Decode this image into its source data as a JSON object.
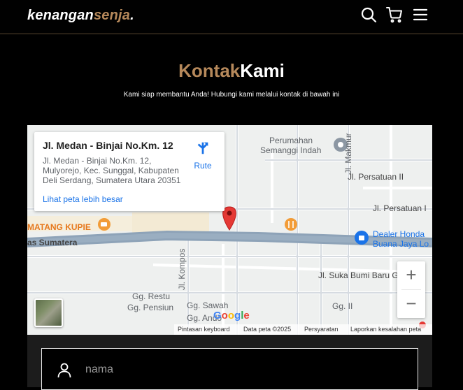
{
  "navbar": {
    "logo_part1": "kenangan",
    "logo_part2": "senja",
    "logo_part3": ".",
    "icons": [
      "search-icon",
      "cart-icon",
      "menu-icon"
    ]
  },
  "contact": {
    "title_part1": "Kontak",
    "title_part2": "Kami",
    "subtitle": "Kami siap membantu Anda! Hubungi kami melalui kontak di bawah ini"
  },
  "map": {
    "place_title": "Jl. Medan - Binjai No.Km. 12",
    "place_address": "Jl. Medan - Binjai No.Km. 12, Mulyorejo, Kec. Sunggal, Kabupaten Deli Serdang, Sumatera Utara 20351",
    "route_label": "Rute",
    "larger_map_link": "Lihat peta lebih besar",
    "labels": {
      "perumahan": "Perumahan",
      "semanggi": "Semanggi Indah",
      "makmur": "Jl. Makmur",
      "persatuan2": "Jl. Persatuan II",
      "persatuan1": "Jl. Persatuan I",
      "matang": "MATANG KUPIE",
      "sumatera": "as Sumatera",
      "dealer1": "Dealer Honda",
      "dealer2": "Buana Jaya Lo",
      "kompos": "Jl. Kompos",
      "sukabumi": "Jl. Suka Bumi Baru G",
      "restu": "Gg. Restu",
      "pensiun": "Gg. Pensiun",
      "sawah": "Gg. Sawah",
      "ando": "Gg. Ando",
      "gg2": "Gg. II"
    },
    "google_text": "Google",
    "footer_keyboard": "Pintasan keyboard",
    "footer_data": "Data peta ©2025",
    "footer_terms": "Persyaratan",
    "footer_report": "Laporkan kesalahan peta",
    "zoom_in": "+",
    "zoom_out": "−"
  },
  "form": {
    "name_placeholder": "nama"
  },
  "colors": {
    "accent": "#b6895b",
    "background": "#000000",
    "form_bg": "#1c1c1c"
  }
}
